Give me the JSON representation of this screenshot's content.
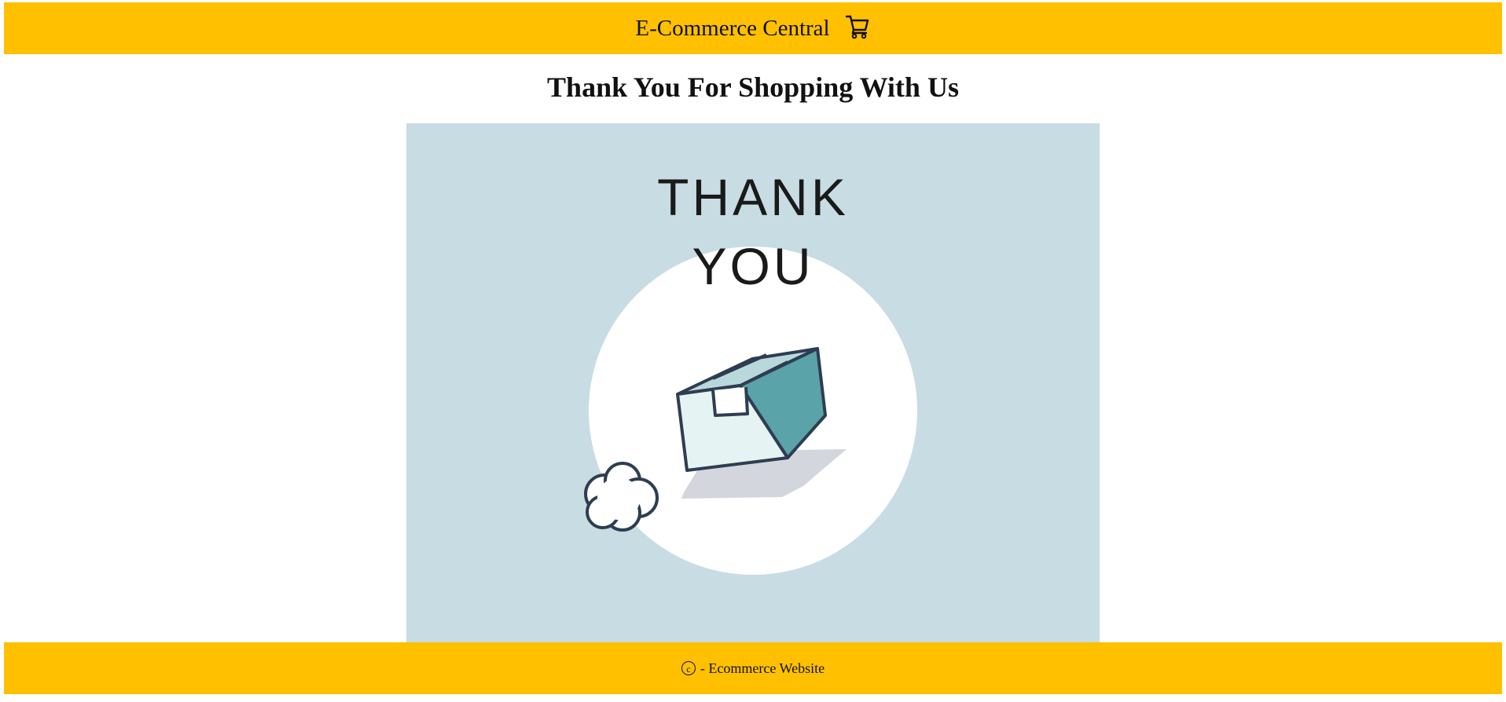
{
  "header": {
    "brand": "E-Commerce Central",
    "cart_icon": "shopping-cart-icon"
  },
  "page": {
    "title": "Thank You For Shopping With Us"
  },
  "hero": {
    "line1": "THANK",
    "line2": "YOU",
    "background_color": "#c8dce4",
    "accent_color": "#5aa3a8"
  },
  "footer": {
    "copyright_symbol": "c",
    "text": "- Ecommerce Website"
  },
  "colors": {
    "bar": "#ffc000"
  }
}
